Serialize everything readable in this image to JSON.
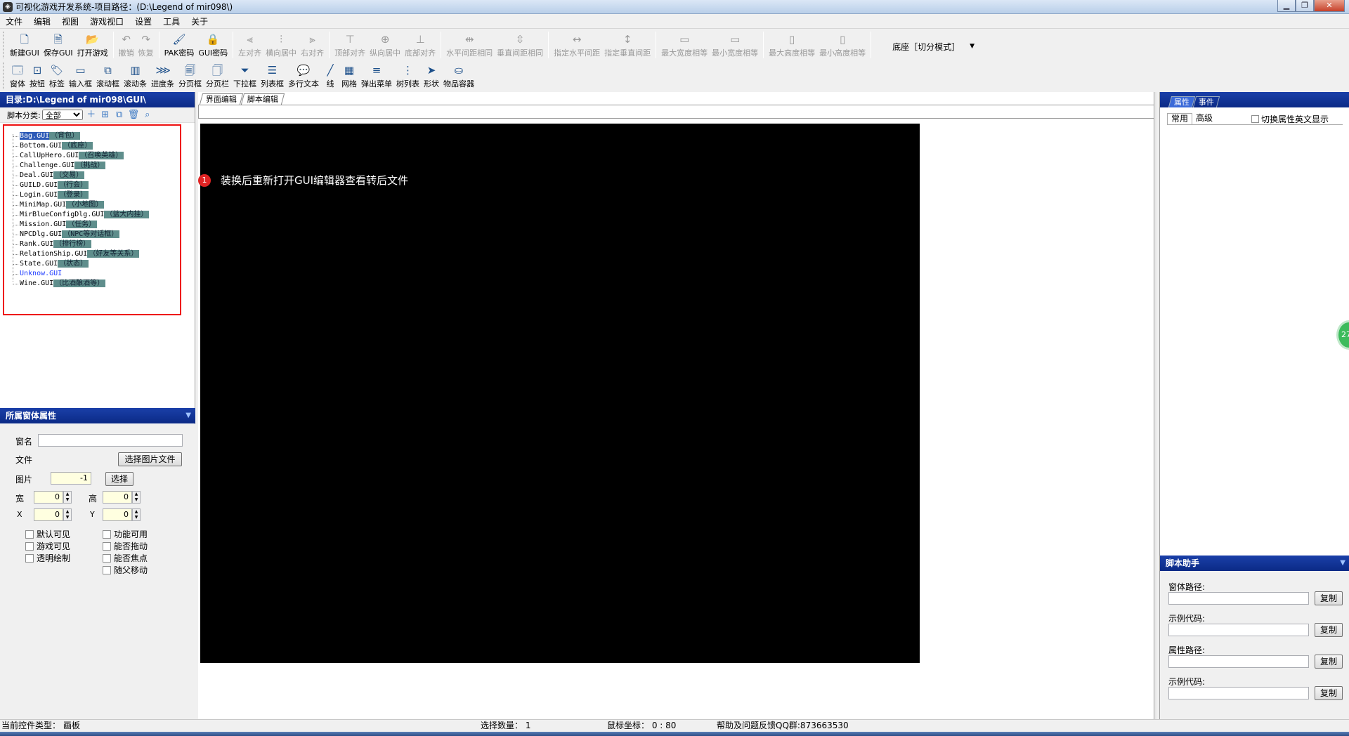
{
  "window": {
    "title": "可视化游戏开发系统-项目路径：(D:\\Legend of mir098\\)",
    "minimize": "▁",
    "restore": "❐",
    "close": "✕"
  },
  "menu": [
    "文件",
    "编辑",
    "视图",
    "游戏视口",
    "设置",
    "工具",
    "关于"
  ],
  "toolbar1": [
    {
      "label": "新建GUI",
      "icon": "new-file-icon",
      "glyph": "🗋",
      "enabled": true
    },
    {
      "label": "保存GUI",
      "icon": "save-icon",
      "glyph": "🗎",
      "enabled": true
    },
    {
      "label": "打开游戏",
      "icon": "open-folder-icon",
      "glyph": "📂",
      "enabled": true
    },
    {
      "label": "撤销",
      "icon": "undo-icon",
      "glyph": "↶",
      "enabled": false
    },
    {
      "label": "恢复",
      "icon": "redo-icon",
      "glyph": "↷",
      "enabled": false
    },
    {
      "label": "PAK密码",
      "icon": "brush-icon",
      "glyph": "🖌",
      "enabled": true
    },
    {
      "label": "GUI密码",
      "icon": "lock-icon",
      "glyph": "🔒",
      "enabled": true
    },
    {
      "label": "左对齐",
      "icon": "align-left-icon",
      "glyph": "⫷",
      "enabled": false
    },
    {
      "label": "横向居中",
      "icon": "align-hcenter-icon",
      "glyph": "⫶",
      "enabled": false
    },
    {
      "label": "右对齐",
      "icon": "align-right-icon",
      "glyph": "⫸",
      "enabled": false
    },
    {
      "label": "顶部对齐",
      "icon": "align-top-icon",
      "glyph": "⊤",
      "enabled": false
    },
    {
      "label": "纵向居中",
      "icon": "align-vcenter-icon",
      "glyph": "⊕",
      "enabled": false
    },
    {
      "label": "底部对齐",
      "icon": "align-bottom-icon",
      "glyph": "⊥",
      "enabled": false
    },
    {
      "label": "水平间距相同",
      "icon": "hspace-equal-icon",
      "glyph": "⇹",
      "enabled": false
    },
    {
      "label": "垂直间距相同",
      "icon": "vspace-equal-icon",
      "glyph": "⇳",
      "enabled": false
    },
    {
      "label": "指定水平间距",
      "icon": "set-hspace-icon",
      "glyph": "↔",
      "enabled": false
    },
    {
      "label": "指定垂直间距",
      "icon": "set-vspace-icon",
      "glyph": "↕",
      "enabled": false
    },
    {
      "label": "最大宽度相等",
      "icon": "max-width-icon",
      "glyph": "▭",
      "enabled": false
    },
    {
      "label": "最小宽度相等",
      "icon": "min-width-icon",
      "glyph": "▭",
      "enabled": false
    },
    {
      "label": "最大高度相等",
      "icon": "max-height-icon",
      "glyph": "▯",
      "enabled": false
    },
    {
      "label": "最小高度相等",
      "icon": "min-height-icon",
      "glyph": "▯",
      "enabled": false
    }
  ],
  "mode_selector": "底座［切分模式］",
  "toolbar2": [
    {
      "label": "窗体",
      "icon": "window-icon",
      "glyph": "🗔"
    },
    {
      "label": "按钮",
      "icon": "button-icon",
      "glyph": "⊡"
    },
    {
      "label": "标签",
      "icon": "label-icon",
      "glyph": "🏷"
    },
    {
      "label": "输入框",
      "icon": "input-box-icon",
      "glyph": "▭"
    },
    {
      "label": "滚动框",
      "icon": "scroll-box-icon",
      "glyph": "⧉"
    },
    {
      "label": "滚动条",
      "icon": "scrollbar-icon",
      "glyph": "▥"
    },
    {
      "label": "进度条",
      "icon": "progress-icon",
      "glyph": "⋙"
    },
    {
      "label": "分页框",
      "icon": "page-frame-icon",
      "glyph": "🗐"
    },
    {
      "label": "分页栏",
      "icon": "page-bar-icon",
      "glyph": "🗍"
    },
    {
      "label": "下拉框",
      "icon": "dropdown-icon",
      "glyph": "⏷"
    },
    {
      "label": "列表框",
      "icon": "listbox-icon",
      "glyph": "☰"
    },
    {
      "label": "多行文本",
      "icon": "multiline-text-icon",
      "glyph": "💬"
    },
    {
      "label": "线",
      "icon": "line-icon",
      "glyph": "╱"
    },
    {
      "label": "网格",
      "icon": "grid-icon",
      "glyph": "▦"
    },
    {
      "label": "弹出菜单",
      "icon": "popup-menu-icon",
      "glyph": "≡"
    },
    {
      "label": "树列表",
      "icon": "tree-list-icon",
      "glyph": "⋮"
    },
    {
      "label": "形状",
      "icon": "shape-icon",
      "glyph": "➤"
    },
    {
      "label": "物品容器",
      "icon": "item-container-icon",
      "glyph": "⛀"
    }
  ],
  "directory": {
    "title": "目录:D:\\Legend of mir098\\GUI\\",
    "category_label": "脚本分类:",
    "category_value": "全部",
    "files": [
      {
        "name": "Bag.GUI",
        "desc": "（背包）"
      },
      {
        "name": "Bottom.GUI",
        "desc": "（底座）"
      },
      {
        "name": "CallUpHero.GUI",
        "desc": "（召唤英雄）"
      },
      {
        "name": "Challenge.GUI",
        "desc": "（挑战）"
      },
      {
        "name": "Deal.GUI",
        "desc": "（交易）"
      },
      {
        "name": "GUILD.GUI",
        "desc": "（行会）"
      },
      {
        "name": "Login.GUI",
        "desc": "（登录）"
      },
      {
        "name": "MiniMap.GUI",
        "desc": "（小地图）"
      },
      {
        "name": "MirBlueConfigDlg.GUI",
        "desc": "（蓝大内挂）"
      },
      {
        "name": "Mission.GUI",
        "desc": "（任务）"
      },
      {
        "name": "NPCDlg.GUI",
        "desc": "（NPC等对话框）"
      },
      {
        "name": "Rank.GUI",
        "desc": "（排行榜）"
      },
      {
        "name": "RelationShip.GUI",
        "desc": "（好友等关系）"
      },
      {
        "name": "State.GUI",
        "desc": "（状态）"
      },
      {
        "name": "Unknow.GUI",
        "desc": ""
      },
      {
        "name": "Wine.GUI",
        "desc": "（比酒酿酒等）"
      }
    ]
  },
  "window_props": {
    "title": "所属窗体属性",
    "name_label": "窗名",
    "name_value": "",
    "file_label": "文件",
    "select_image_button": "选择图片文件",
    "image_label": "图片",
    "image_value": "-1",
    "select_button": "选择",
    "width_label": "宽",
    "width_value": "0",
    "height_label": "高",
    "height_value": "0",
    "x_label": "X",
    "x_value": "0",
    "y_label": "Y",
    "y_value": "0",
    "checkboxes_left": [
      "默认可见",
      "游戏可见",
      "透明绘制"
    ],
    "checkboxes_right": [
      "功能可用",
      "能否拖动",
      "能否焦点",
      "随父移动"
    ]
  },
  "editor": {
    "tabs": [
      "界面编辑",
      "脚本编辑"
    ],
    "note_badge": "1",
    "note_text": "装换后重新打开GUI编辑器查看转后文件"
  },
  "right_panel": {
    "tabs": [
      "属性",
      "事件"
    ],
    "subtabs": [
      "常用",
      "高级"
    ],
    "english_toggle": "切换属性英文显示",
    "script_helper_title": "脚本助手",
    "fields": [
      {
        "label": "窗体路径:",
        "button": "复制"
      },
      {
        "label": "示例代码:",
        "button": "复制"
      },
      {
        "label": "属性路径:",
        "button": "复制"
      },
      {
        "label": "示例代码:",
        "button": "复制"
      }
    ]
  },
  "floating_badge": "27",
  "status": {
    "control_type": "当前控件类型： 画板",
    "selection_count": "选择数量： 1",
    "mouse_coords": "鼠标坐标： 0 : 80",
    "help": "帮助及问题反馈QQ群:873663530"
  }
}
